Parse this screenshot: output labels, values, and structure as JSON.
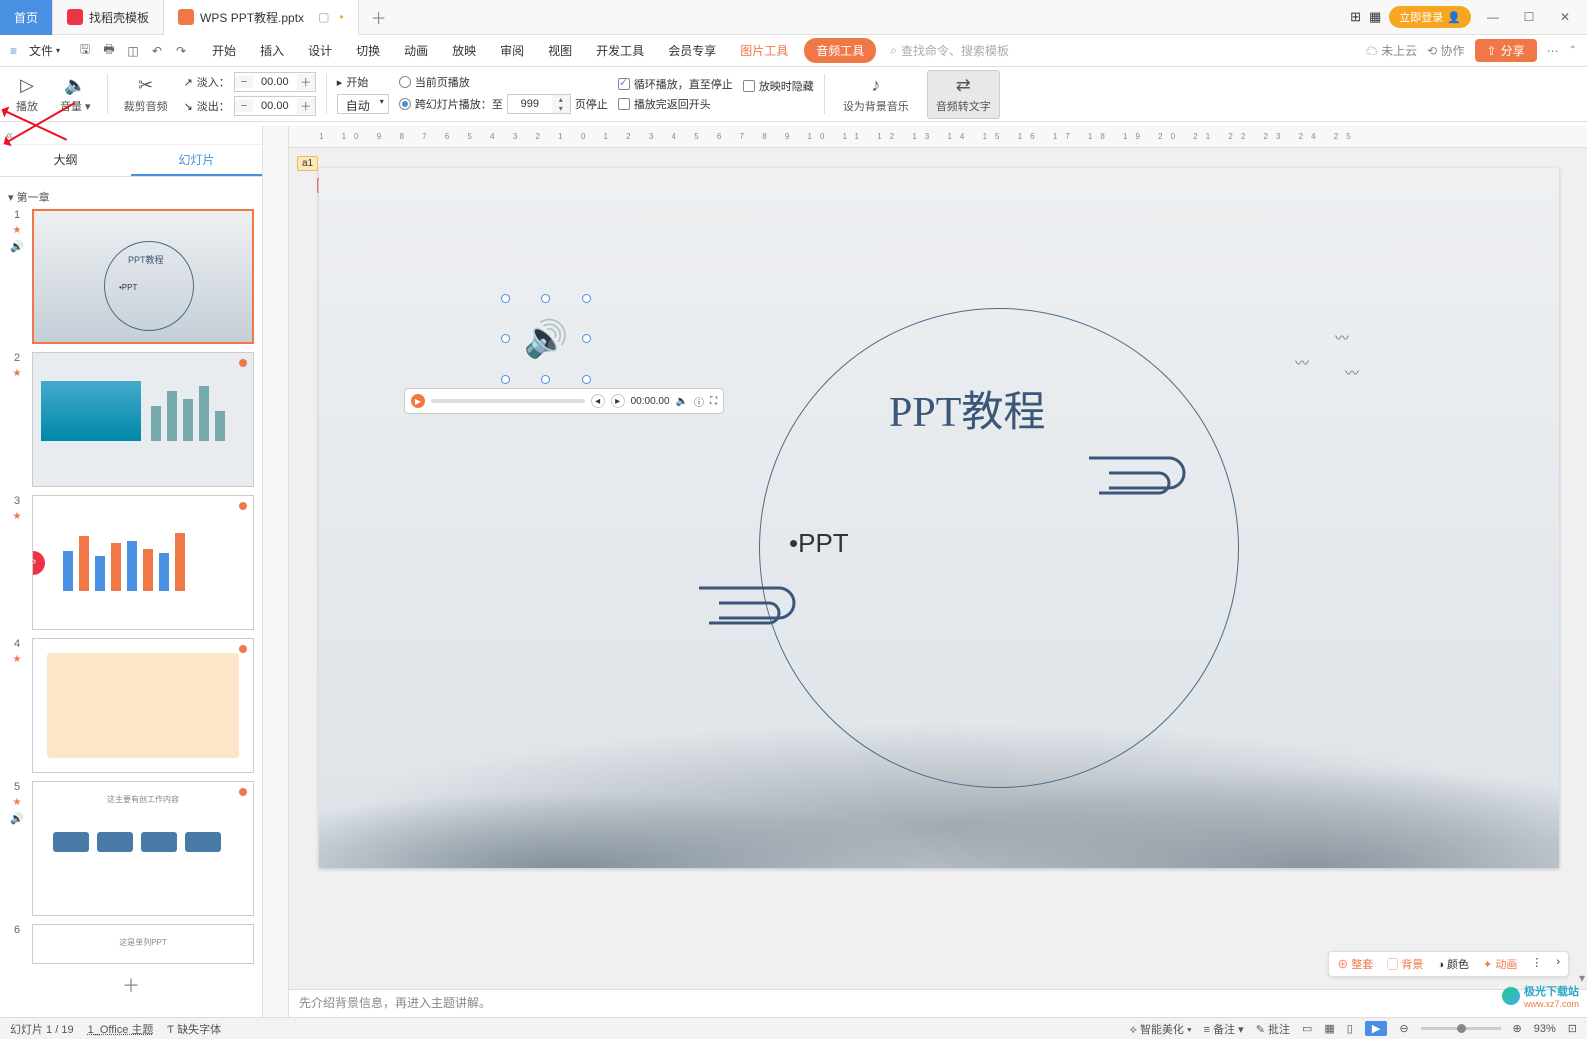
{
  "tabs": {
    "home": "首页",
    "template": "找稻壳模板",
    "file": "WPS PPT教程.pptx"
  },
  "titlebar": {
    "login": "立即登录"
  },
  "menu": {
    "file": "文件",
    "items": [
      "开始",
      "插入",
      "设计",
      "切换",
      "动画",
      "放映",
      "审阅",
      "视图",
      "开发工具",
      "会员专享"
    ],
    "pic_tools": "图片工具",
    "audio_tools": "音频工具",
    "search_ph": "查找命令、搜索模板",
    "cloud": "未上云",
    "collab": "协作",
    "share": "分享"
  },
  "ribbon": {
    "play": "播放",
    "volume": "音量",
    "trim": "裁剪音频",
    "fadein_lbl": "淡入：",
    "fadeout_lbl": "淡出：",
    "fade_val": "00.00",
    "start_lbl": "开始",
    "auto": "自动",
    "current_page": "当前页播放",
    "loop": "循环播放，直至停止",
    "hide_show": "放映时隐藏",
    "cross_slide": "跨幻灯片播放：至",
    "cross_val": "999",
    "page_stop": "页停止",
    "return_start": "播放完返回开头",
    "set_bg": "设为背景音乐",
    "audio2text": "音频转文字"
  },
  "left": {
    "outline": "大纲",
    "slides": "幻灯片",
    "chapter1": "第一章"
  },
  "slide": {
    "title": "PPT教程",
    "bullet": "•PPT",
    "thumb_title": "PPT教程",
    "thumb_sub": "•PPT",
    "audio_time": "00:00.00",
    "comment1": "a1",
    "comment2": "a1"
  },
  "thumbs": {
    "nums": [
      "1",
      "2",
      "3",
      "4",
      "5",
      "6"
    ],
    "t5_title": "这主要有创工作内容",
    "t6_title": "这是单列PPT"
  },
  "float": {
    "suite": "整套",
    "bg": "背景",
    "color": "颜色",
    "anim": "动画"
  },
  "notes": "先介绍背景信息，再进入主题讲解。",
  "status": {
    "slide": "幻灯片 1 / 19",
    "theme": "1_Office 主题",
    "font": "缺失字体",
    "beautify": "智能美化",
    "notes_btn": "备注",
    "comments_btn": "批注",
    "zoom": "93%"
  },
  "watermark": {
    "site": "极光下载站",
    "url": "www.xz7.com"
  }
}
